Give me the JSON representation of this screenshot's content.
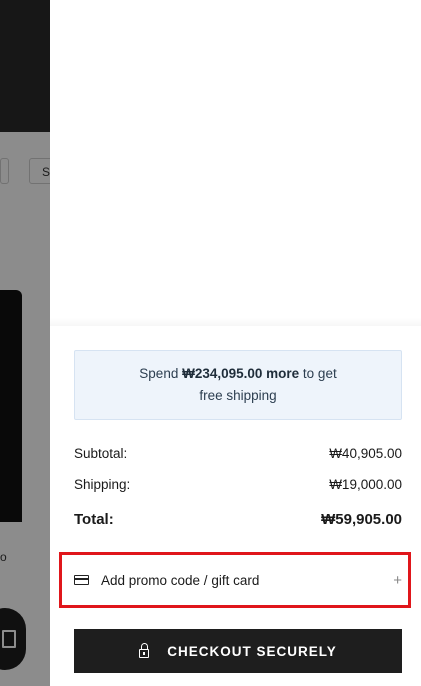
{
  "background": {
    "filter_chip_label": "S"
  },
  "cart_summary": {
    "shipping_notice": {
      "prefix": "Spend ",
      "amount": "₩234,095.00 more",
      "suffix": " to get",
      "line2": "free shipping"
    },
    "subtotal": {
      "label": "Subtotal:",
      "value": "₩40,905.00"
    },
    "shipping": {
      "label": "Shipping:",
      "value": "₩19,000.00"
    },
    "total": {
      "label": "Total:",
      "value": "₩59,905.00"
    },
    "promo": {
      "label": "Add promo code / gift card",
      "icon": "credit-card-icon",
      "expand_glyph": "+"
    },
    "checkout_button": {
      "label": "CHECKOUT SECURELY",
      "icon": "lock-icon"
    }
  },
  "colors": {
    "highlight": "#e0161b",
    "checkout_bg": "#1e1e1e",
    "notice_bg": "#eef4fb"
  }
}
